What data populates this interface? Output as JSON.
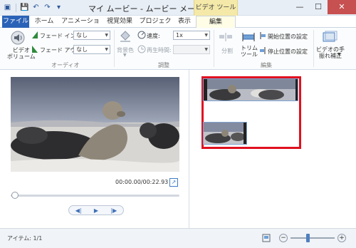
{
  "window": {
    "title": "マイ ムービー - ムービー メーカー",
    "context_tab_header": "ビデオ ツール",
    "controls": {
      "minimize": "—",
      "maximize": "☐",
      "close": "✕"
    }
  },
  "tabs": [
    {
      "label": "ファイル"
    },
    {
      "label": "ホーム"
    },
    {
      "label": "アニメーション"
    },
    {
      "label": "視覚効果"
    },
    {
      "label": "プロジェクト"
    },
    {
      "label": "表示"
    },
    {
      "label": "編集"
    }
  ],
  "ribbon": {
    "audio": {
      "video_volume": "ビデオ\nボリューム",
      "fade_in_label": "フェード イン:",
      "fade_in_value": "なし",
      "fade_out_label": "フェード アウト:",
      "fade_out_value": "なし",
      "group_label": "オーディオ"
    },
    "adjust": {
      "bg_color": "背景色",
      "speed_label": "速度:",
      "speed_value": "1x",
      "duration_label": "再生時間:",
      "group_label": "調整"
    },
    "edit": {
      "split": "分割",
      "trim_tool": "トリム\nツール",
      "set_start": "開始位置の設定",
      "set_end": "停止位置の設定",
      "group_label": "編集"
    },
    "stabilize": {
      "label": "ビデオの手\n振れ補正"
    }
  },
  "preview": {
    "time": "00:00.00/00:22.93"
  },
  "status": {
    "items": "アイテム: 1/1"
  }
}
